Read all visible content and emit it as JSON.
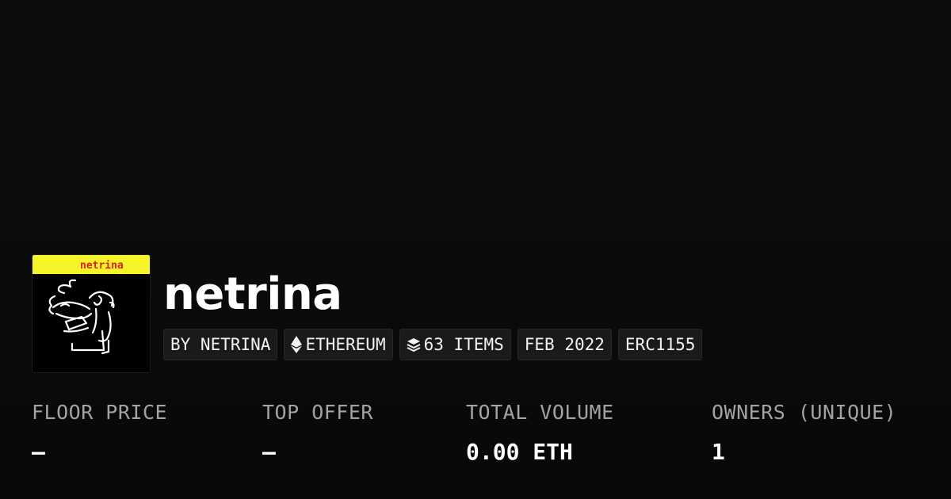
{
  "collection": {
    "name": "netrina",
    "avatar_logo_text": "netrina",
    "avatar_colors": {
      "strip": "#f5f52a",
      "logo_text": "#e21b1b",
      "art_line": "#ffffff",
      "background": "#000000"
    }
  },
  "chips": {
    "creator": "BY NETRINA",
    "chain": {
      "icon": "ethereum-icon",
      "label": "ETHEREUM"
    },
    "items": {
      "icon": "layers-icon",
      "label": "63 ITEMS"
    },
    "date": "FEB 2022",
    "standard": "ERC1155"
  },
  "stats": {
    "floor_price": {
      "label": "FLOOR PRICE",
      "value": "—"
    },
    "top_offer": {
      "label": "TOP OFFER",
      "value": "—"
    },
    "total_volume": {
      "label": "TOTAL VOLUME",
      "value": "0.00 ETH"
    },
    "owners": {
      "label": "OWNERS (UNIQUE)",
      "value": "1"
    }
  },
  "theme": {
    "background": "#0b0b0b",
    "chip_background": "#1a1a1a",
    "label_color": "#a3a3a3"
  }
}
